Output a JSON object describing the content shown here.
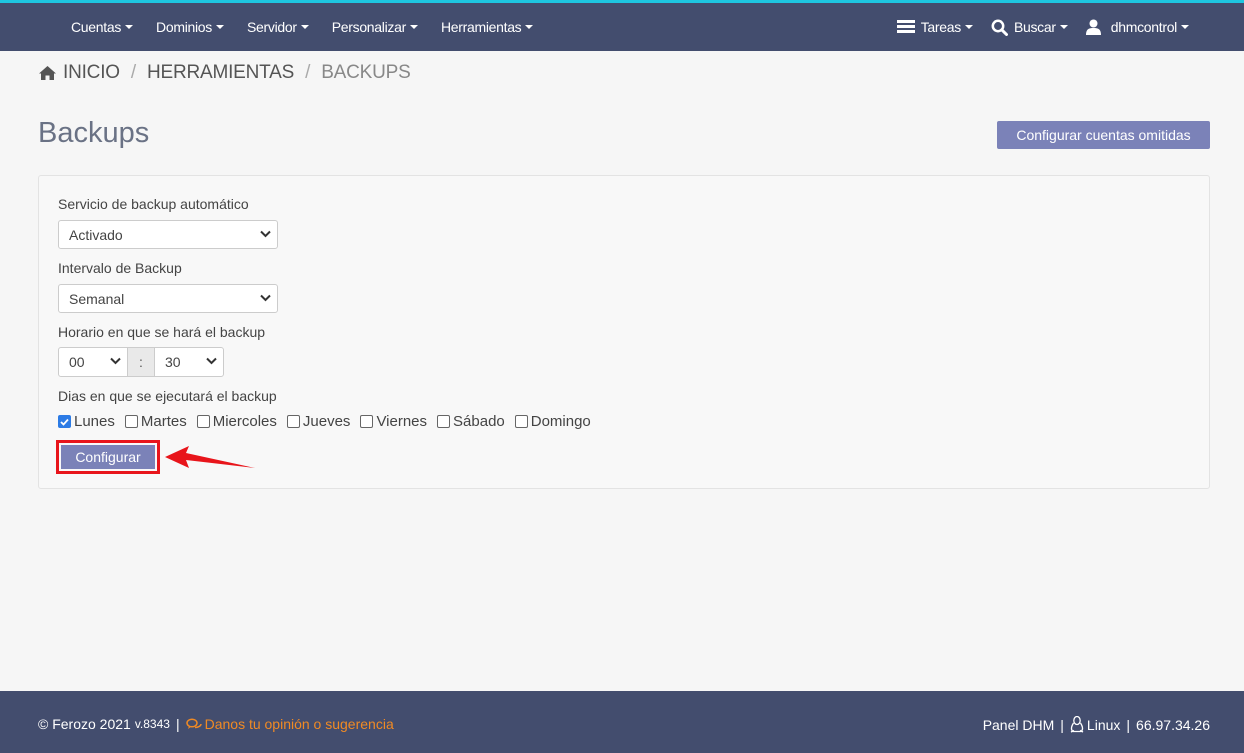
{
  "nav": {
    "left": [
      "Cuentas",
      "Dominios",
      "Servidor",
      "Personalizar",
      "Herramientas"
    ],
    "tasks": "Tareas",
    "search": "Buscar",
    "user": "dhmcontrol"
  },
  "breadcrumb": {
    "home": "INICIO",
    "section": "HERRAMIENTAS",
    "current": "BACKUPS"
  },
  "page": {
    "title": "Backups",
    "omit_button": "Configurar cuentas omitidas"
  },
  "form": {
    "service_label": "Servicio de backup automático",
    "service_value": "Activado",
    "interval_label": "Intervalo de Backup",
    "interval_value": "Semanal",
    "schedule_label": "Horario en que se hará el backup",
    "hour": "00",
    "separator": ":",
    "minute": "30",
    "days_label": "Dias en que se ejecutará el backup",
    "days": [
      {
        "label": "Lunes",
        "checked": true
      },
      {
        "label": "Martes",
        "checked": false
      },
      {
        "label": "Miercoles",
        "checked": false
      },
      {
        "label": "Jueves",
        "checked": false
      },
      {
        "label": "Viernes",
        "checked": false
      },
      {
        "label": "Sábado",
        "checked": false
      },
      {
        "label": "Domingo",
        "checked": false
      }
    ],
    "submit": "Configurar"
  },
  "footer": {
    "copyright": "© Ferozo 2021",
    "version": "v.8343",
    "feedback": "Danos tu opinión o sugerencia",
    "panel": "Panel DHM",
    "os": "Linux",
    "ip": "66.97.34.26"
  },
  "colors": {
    "nav_bg": "#434d6e",
    "accent": "#1ec6e0",
    "button": "#7b82b8",
    "highlight": "#e8151b",
    "feedback": "#f08a24"
  }
}
